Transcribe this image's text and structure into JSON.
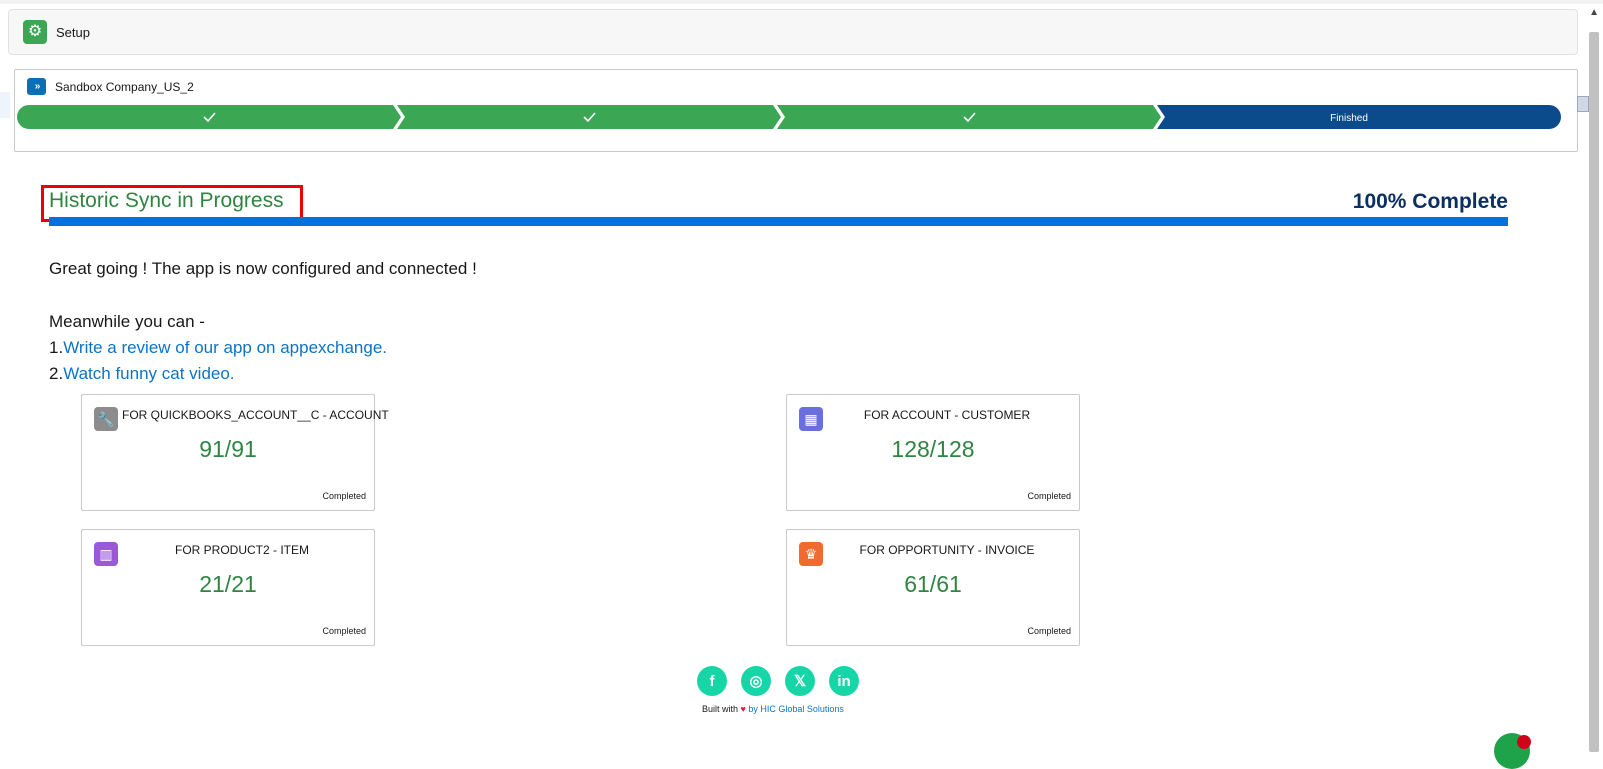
{
  "setup": {
    "title": "Setup",
    "icon": "gear-icon"
  },
  "sandbox": {
    "name": "Sandbox Company_US_2",
    "icon": "double-chevron-icon",
    "steps": [
      {
        "label": "",
        "state": "complete"
      },
      {
        "label": "",
        "state": "complete"
      },
      {
        "label": "",
        "state": "complete"
      },
      {
        "label": "Finished",
        "state": "current"
      }
    ]
  },
  "sync": {
    "title": "Historic Sync in Progress",
    "complete_label": "100% Complete",
    "progress_percent": 100
  },
  "message": {
    "greeting": "Great going ! The app is now configured and connected !",
    "meanwhile": "Meanwhile you can -",
    "item1_prefix": "1.",
    "item1_link": "Write a review of our app on appexchange.",
    "item2_prefix": "2.",
    "item2_link": "Watch funny cat video."
  },
  "cards": [
    {
      "title": "FOR QUICKBOOKS_ACCOUNT__C - ACCOUNT",
      "value": "91/91",
      "status": "Completed",
      "icon": "wrench-icon",
      "color": "#8c8c8c"
    },
    {
      "title": "FOR ACCOUNT - CUSTOMER",
      "value": "128/128",
      "status": "Completed",
      "icon": "building-icon",
      "color": "#6b6ee0"
    },
    {
      "title": "FOR PRODUCT2 - ITEM",
      "value": "21/21",
      "status": "Completed",
      "icon": "barcode-icon",
      "color": "#9b59d9"
    },
    {
      "title": "FOR OPPORTUNITY - INVOICE",
      "value": "61/61",
      "status": "Completed",
      "icon": "crown-icon",
      "color": "#f26b2e"
    }
  ],
  "social": [
    {
      "glyph": "f",
      "icon": "facebook-icon"
    },
    {
      "glyph": "◎",
      "icon": "instagram-icon"
    },
    {
      "glyph": "𝕏",
      "icon": "x-icon"
    },
    {
      "glyph": "in",
      "icon": "linkedin-icon"
    }
  ],
  "footer": {
    "built_with": "Built with",
    "heart": "♥",
    "by": "by HIC Global Solutions"
  },
  "colors": {
    "green": "#3ba755",
    "navy": "#0b4a8b",
    "progress": "#0470d9",
    "title_green": "#2e8540"
  }
}
